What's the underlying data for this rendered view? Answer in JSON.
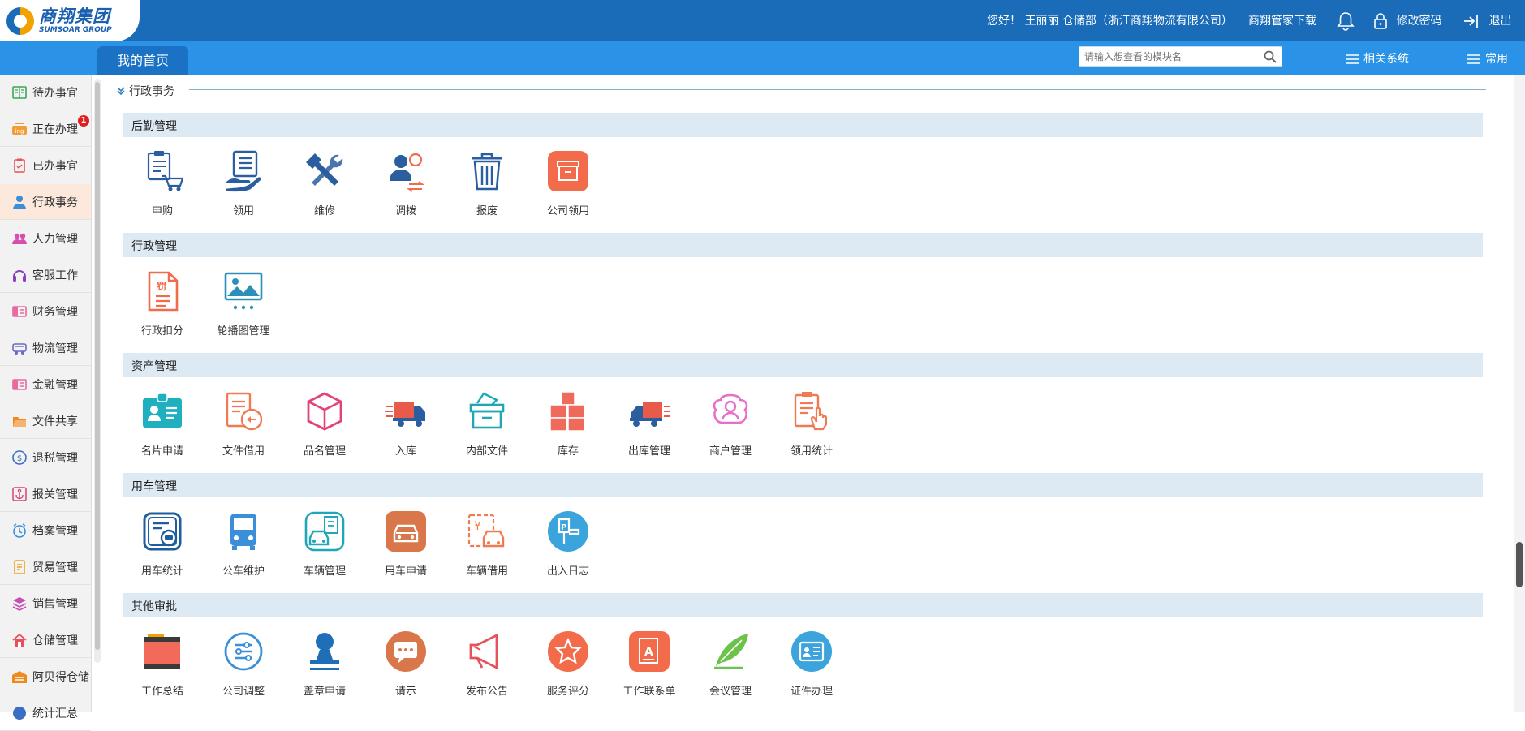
{
  "brand": {
    "cn": "商翔集团",
    "en": "SUMSOAR GROUP"
  },
  "header": {
    "greeting": "您好！ 王丽丽 仓储部（浙江商翔物流有限公司）",
    "download": "商翔管家下载",
    "change_password": "修改密码",
    "logout": "退出"
  },
  "nav": {
    "home_tab": "我的首页",
    "search_placeholder": "请输入想查看的模块名",
    "related_systems": "相关系统",
    "common": "常用"
  },
  "sidebar": {
    "items": [
      {
        "label": "待办事宜",
        "icon": "book-icon",
        "color": "#3aa655"
      },
      {
        "label": "正在办理",
        "icon": "ing-icon",
        "color": "#f29d38",
        "badge": "1"
      },
      {
        "label": "已办事宜",
        "icon": "clipboard-icon",
        "color": "#e8515b"
      },
      {
        "label": "行政事务",
        "icon": "person-icon",
        "color": "#3b8fd8",
        "active": true
      },
      {
        "label": "人力管理",
        "icon": "people-icon",
        "color": "#d64fae"
      },
      {
        "label": "客服工作",
        "icon": "headset-icon",
        "color": "#8a3fc2"
      },
      {
        "label": "财务管理",
        "icon": "money-icon",
        "color": "#e96aa0"
      },
      {
        "label": "物流管理",
        "icon": "truck-icon",
        "color": "#6a6ac8"
      },
      {
        "label": "金融管理",
        "icon": "finance-icon",
        "color": "#e96aa0"
      },
      {
        "label": "文件共享",
        "icon": "folder-icon",
        "color": "#f08a1c"
      },
      {
        "label": "退税管理",
        "icon": "tax-icon",
        "color": "#3b6fc4"
      },
      {
        "label": "报关管理",
        "icon": "anchor-icon",
        "color": "#d6456d"
      },
      {
        "label": "档案管理",
        "icon": "clock-icon",
        "color": "#3b8fd8"
      },
      {
        "label": "贸易管理",
        "icon": "document-icon",
        "color": "#f0a21c"
      },
      {
        "label": "销售管理",
        "icon": "layers-icon",
        "color": "#c44fb6"
      },
      {
        "label": "仓储管理",
        "icon": "house-icon",
        "color": "#e8515b"
      },
      {
        "label": "阿贝得仓储",
        "icon": "warehouse-icon",
        "color": "#f08a1c"
      },
      {
        "label": "统计汇总",
        "icon": "chart-icon",
        "color": "#3b6fc4"
      }
    ]
  },
  "main": {
    "section_title": "行政事务",
    "groups": [
      {
        "title": "后勤管理",
        "items": [
          {
            "label": "申购",
            "icon": "purchase-cart-icon",
            "color": "#2b5e9e"
          },
          {
            "label": "领用",
            "icon": "receive-hand-icon",
            "color": "#2b5e9e"
          },
          {
            "label": "维修",
            "icon": "repair-tools-icon",
            "color": "#2b5e9e"
          },
          {
            "label": "调拨",
            "icon": "transfer-person-icon",
            "color": "#2b5e9e"
          },
          {
            "label": "报废",
            "icon": "trash-icon",
            "color": "#2b5e9e"
          },
          {
            "label": "公司领用",
            "icon": "company-box-icon",
            "color": "#f26b4a"
          }
        ]
      },
      {
        "title": "行政管理",
        "items": [
          {
            "label": "行政扣分",
            "icon": "penalty-doc-icon",
            "color": "#f26b4a"
          },
          {
            "label": "轮播图管理",
            "icon": "carousel-image-icon",
            "color": "#2b8fb8"
          }
        ]
      },
      {
        "title": "资产管理",
        "items": [
          {
            "label": "名片申请",
            "icon": "business-card-icon",
            "color": "#1fb0bf"
          },
          {
            "label": "文件借用",
            "icon": "file-borrow-icon",
            "color": "#f07a52"
          },
          {
            "label": "品名管理",
            "icon": "cube-icon",
            "color": "#e0457a"
          },
          {
            "label": "入库",
            "icon": "inbound-truck-icon",
            "color": "#e85a4a"
          },
          {
            "label": "内部文件",
            "icon": "file-box-icon",
            "color": "#1fa7b8"
          },
          {
            "label": "库存",
            "icon": "stock-boxes-icon",
            "color": "#ef6a5a"
          },
          {
            "label": "出库管理",
            "icon": "outbound-truck-icon",
            "color": "#e85a4a"
          },
          {
            "label": "商户管理",
            "icon": "merchant-icon",
            "color": "#e86fc8"
          },
          {
            "label": "领用统计",
            "icon": "usage-stats-icon",
            "color": "#f07a52"
          }
        ]
      },
      {
        "title": "用车管理",
        "items": [
          {
            "label": "用车统计",
            "icon": "car-stats-icon",
            "color": "#1f5e9e"
          },
          {
            "label": "公车维护",
            "icon": "bus-icon",
            "color": "#3b8fd8"
          },
          {
            "label": "车辆管理",
            "icon": "vehicle-manage-icon",
            "color": "#1fa7b8"
          },
          {
            "label": "用车申请",
            "icon": "car-request-icon",
            "color": "#d9774a"
          },
          {
            "label": "车辆借用",
            "icon": "car-borrow-icon",
            "color": "#f07a52"
          },
          {
            "label": "出入日志",
            "icon": "parking-log-icon",
            "color": "#3ba4dd"
          }
        ]
      },
      {
        "title": "其他审批",
        "items": [
          {
            "label": "工作总结",
            "icon": "work-summary-icon",
            "color": "#e85a4a"
          },
          {
            "label": "公司调整",
            "icon": "adjust-sliders-icon",
            "color": "#3b8fd8"
          },
          {
            "label": "盖章申请",
            "icon": "stamp-icon",
            "color": "#1f6fb8"
          },
          {
            "label": "请示",
            "icon": "chat-bubble-icon",
            "color": "#d9774a"
          },
          {
            "label": "发布公告",
            "icon": "megaphone-icon",
            "color": "#e8515b"
          },
          {
            "label": "服务评分",
            "icon": "star-badge-icon",
            "color": "#f26b4a"
          },
          {
            "label": "工作联系单",
            "icon": "contact-sheet-icon",
            "color": "#f26b4a"
          },
          {
            "label": "会议管理",
            "icon": "quill-icon",
            "color": "#6cc24a"
          },
          {
            "label": "证件办理",
            "icon": "id-card-icon",
            "color": "#3ba4dd"
          }
        ]
      }
    ]
  }
}
